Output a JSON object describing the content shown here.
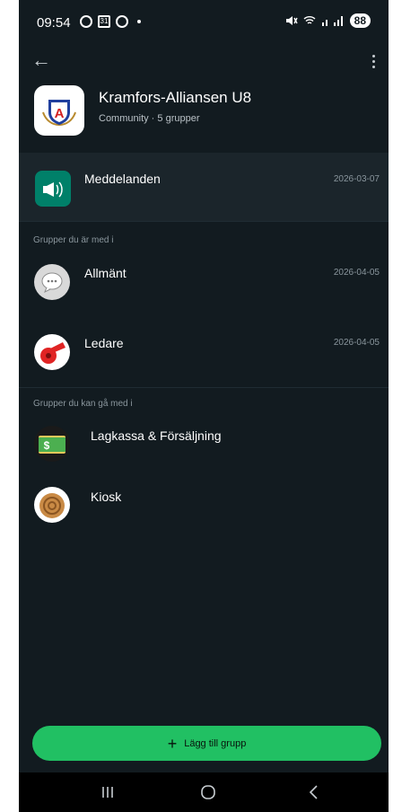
{
  "status_bar": {
    "time": "09:54",
    "calendar_day": "31",
    "battery": "88"
  },
  "community": {
    "name": "Kramfors-Alliansen U8",
    "subtitle": "Community · 5 grupper",
    "logo_letter": "A"
  },
  "announcements": {
    "title": "Meddelanden",
    "date": "2026-03-07"
  },
  "joined_section": {
    "label": "Grupper du är med i",
    "groups": [
      {
        "name": "Allmänt",
        "date": "2026-04-05",
        "icon": "speech-bubble-icon"
      },
      {
        "name": "Ledare",
        "date": "2026-04-05",
        "icon": "whistle-icon"
      }
    ]
  },
  "joinable_section": {
    "label": "Grupper du kan gå med i",
    "groups": [
      {
        "name": "Lagkassa & Försäljning",
        "icon": "money-icon"
      },
      {
        "name": "Kiosk",
        "icon": "cinnamon-bun-icon"
      }
    ]
  },
  "add_button": {
    "label": "Lägg till grupp",
    "icon": "plus-icon"
  },
  "colors": {
    "background": "#121b20",
    "accent": "#21c063",
    "announcement_bg": "#1b252b"
  }
}
